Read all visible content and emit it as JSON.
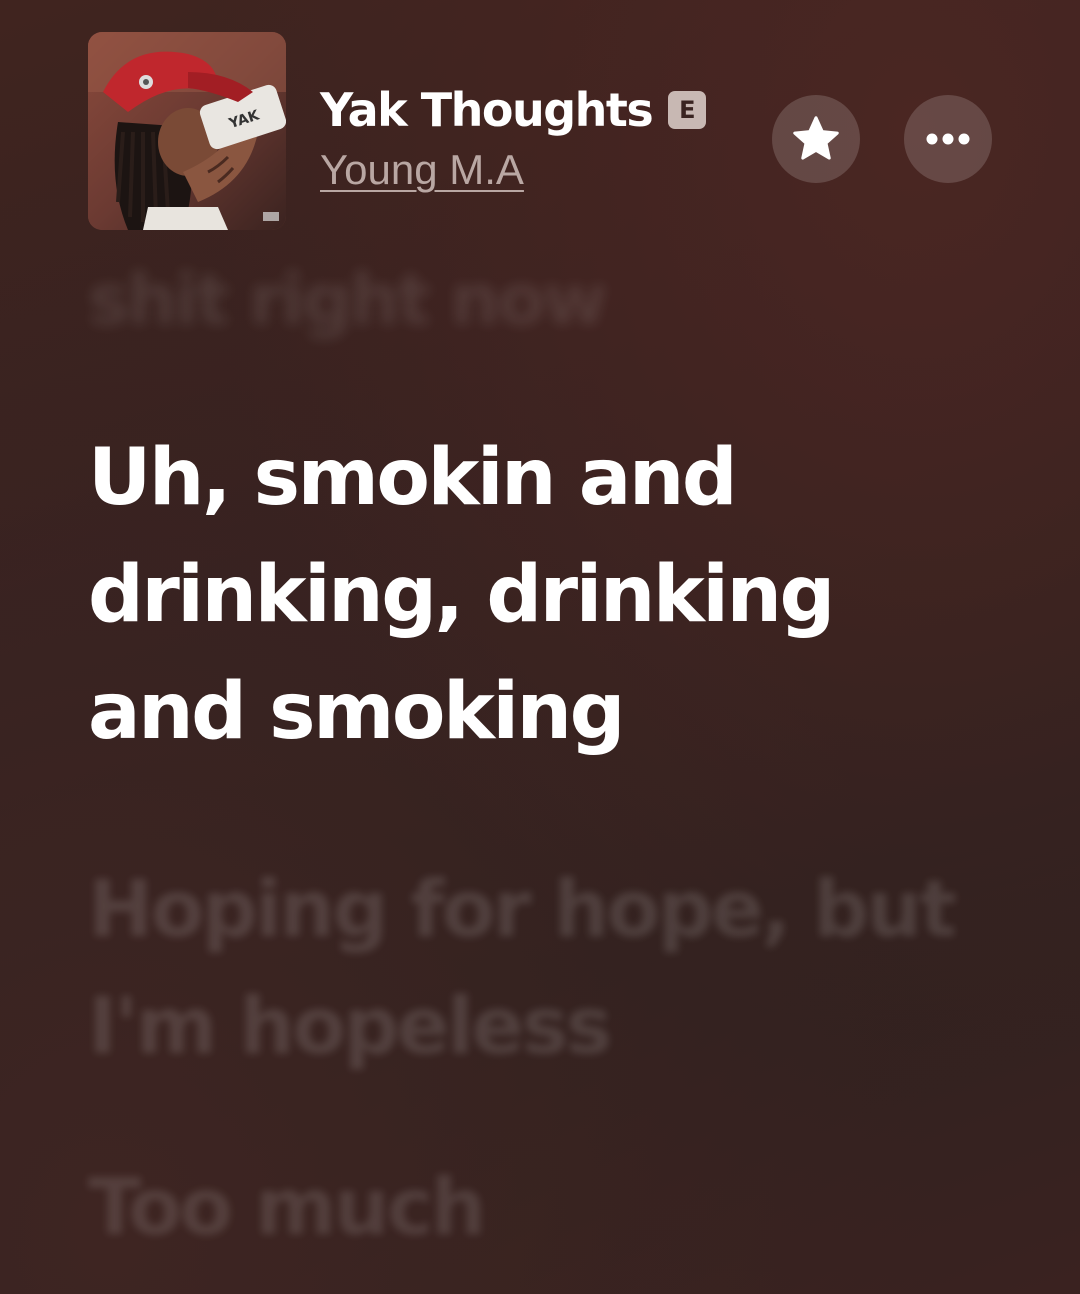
{
  "song": {
    "title": "Yak Thoughts",
    "explicit_badge": "E",
    "artist": "Young M.A"
  },
  "artwork": {
    "cover_text": "YAK",
    "accent_color": "#c0272d"
  },
  "actions": {
    "star_icon": "star-icon",
    "more_icon": "ellipsis-icon"
  },
  "lyrics": {
    "previous": "shit right now",
    "current": "Uh, smokin and drinking, drinking and smoking",
    "next": "Hoping for hope, but I'm hopeless",
    "upcoming": "Too much"
  }
}
